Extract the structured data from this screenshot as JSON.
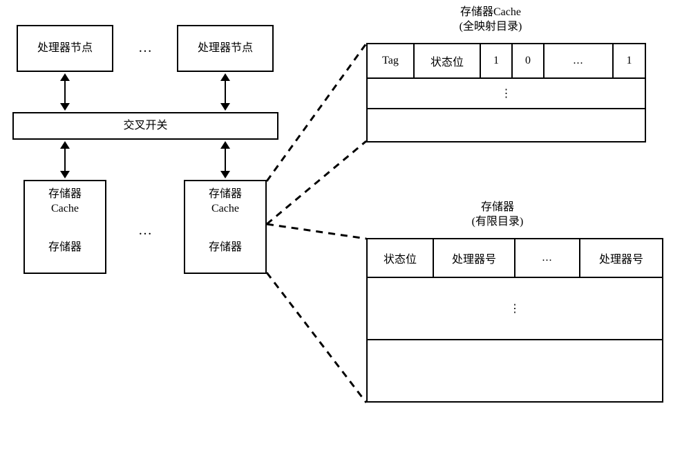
{
  "processor_left": "处理器节点",
  "processor_right": "处理器节点",
  "processor_ellipsis": "…",
  "crossbar": "交叉开关",
  "memcache_left": "存储器\nCache",
  "mem_left": "存储器",
  "memcache_right": "存储器\nCache",
  "mem_right": "存储器",
  "mem_ellipsis": "…",
  "table1_title": "存储器Cache\n(全映射目录)",
  "table1": {
    "tag": "Tag",
    "status": "状态位",
    "b1": "1",
    "b0": "0",
    "dots": "...",
    "bn": "1",
    "vdots": "⋮"
  },
  "table2_title": "存储器\n(有限目录)",
  "table2": {
    "status": "状态位",
    "proc1": "处理器号",
    "dots": "...",
    "procn": "处理器号",
    "vdots": "⋮"
  }
}
